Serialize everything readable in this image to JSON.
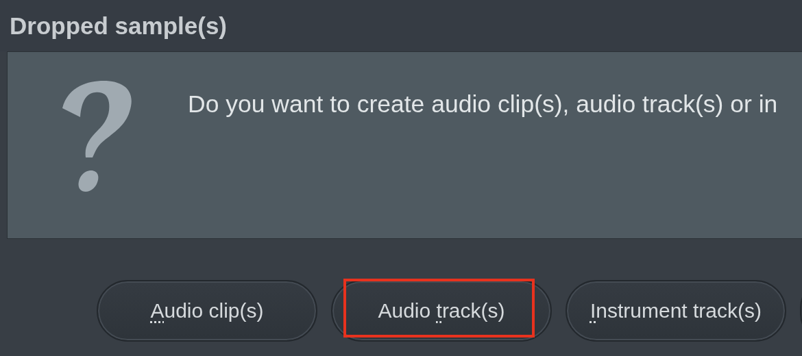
{
  "window": {
    "title": "Dropped sample(s)"
  },
  "message": "Do you want to create audio clip(s), audio track(s) or in",
  "buttons": [
    {
      "key": "A",
      "after": "udio clip(s)",
      "highlighted": false
    },
    {
      "before": "Audio ",
      "key": "t",
      "after": "rack(s)",
      "highlighted": true
    },
    {
      "key": "I",
      "after": "nstrument track(s)",
      "highlighted": false
    }
  ]
}
